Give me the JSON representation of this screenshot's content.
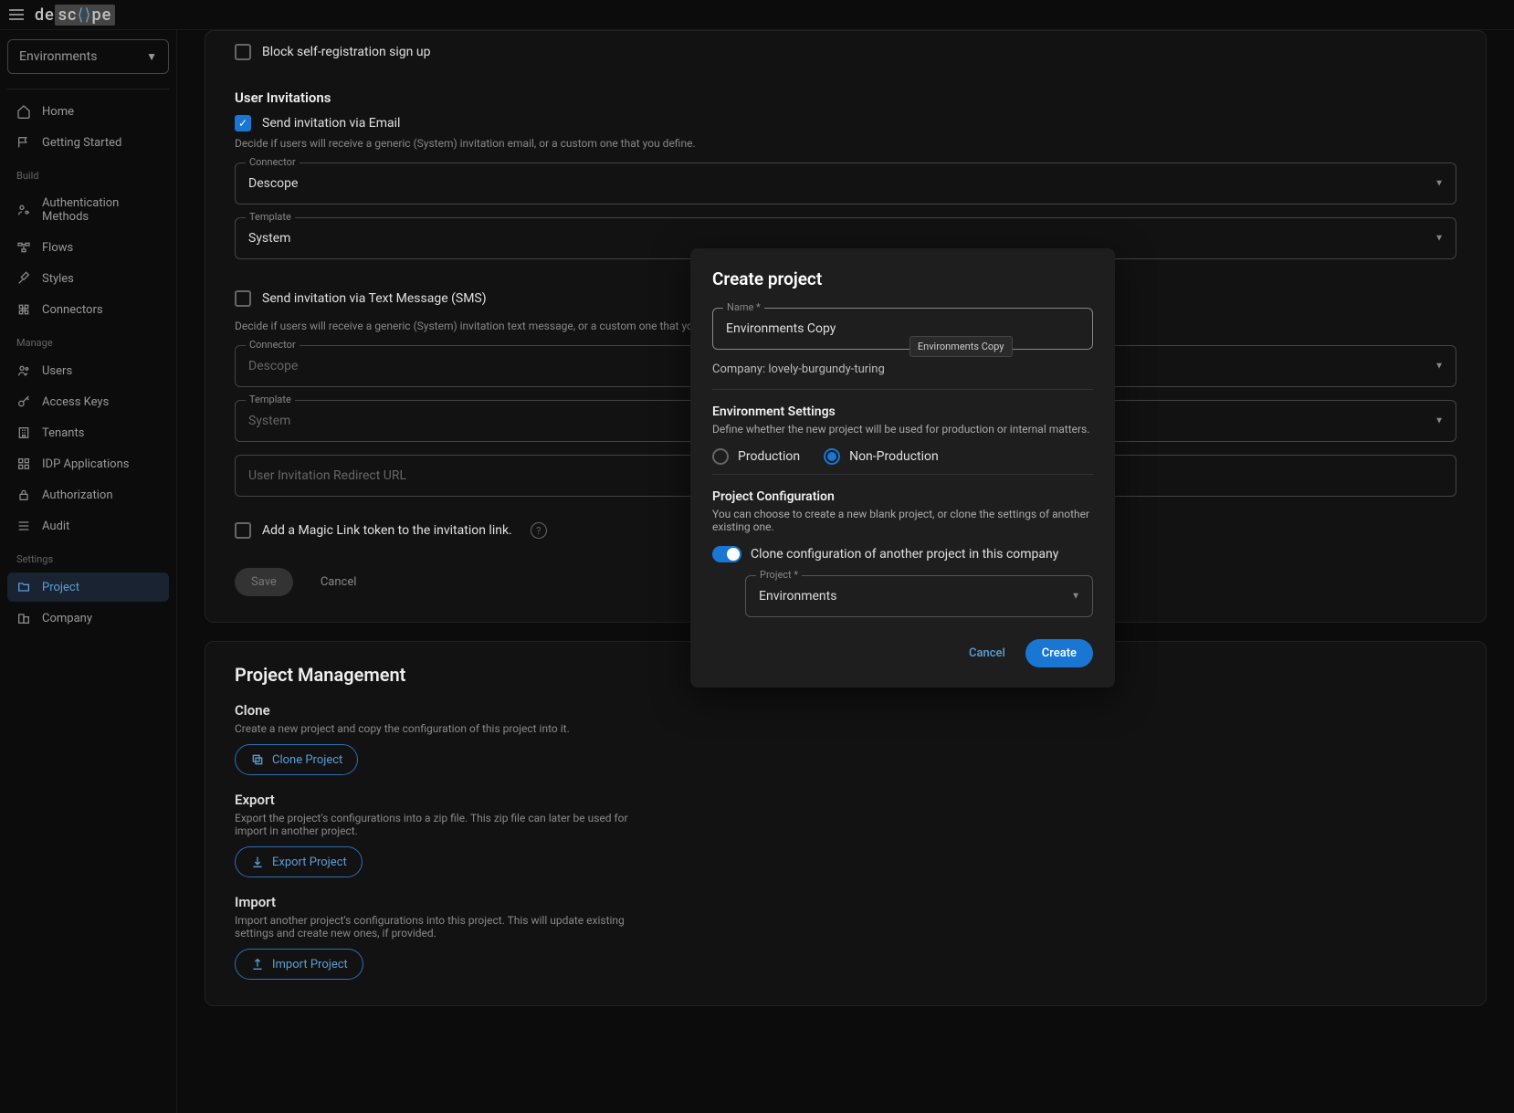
{
  "logo_text": "descope",
  "env_selector": "Environments",
  "sidebar": {
    "items_top": [
      {
        "label": "Home"
      },
      {
        "label": "Getting Started"
      }
    ],
    "section_build": "Build",
    "items_build": [
      {
        "label": "Authentication Methods"
      },
      {
        "label": "Flows"
      },
      {
        "label": "Styles"
      },
      {
        "label": "Connectors"
      }
    ],
    "section_manage": "Manage",
    "items_manage": [
      {
        "label": "Users"
      },
      {
        "label": "Access Keys"
      },
      {
        "label": "Tenants"
      },
      {
        "label": "IDP Applications"
      },
      {
        "label": "Authorization"
      },
      {
        "label": "Audit"
      }
    ],
    "section_settings": "Settings",
    "items_settings": [
      {
        "label": "Project"
      },
      {
        "label": "Company"
      }
    ]
  },
  "page": {
    "block_self_reg": "Block self-registration sign up",
    "user_invitations": "User Invitations",
    "send_email": "Send invitation via Email",
    "email_hint": "Decide if users will receive a generic (System) invitation email, or a custom one that you define.",
    "connector_label": "Connector",
    "connector_value": "Descope",
    "template_label": "Template",
    "template_value": "System",
    "send_sms": "Send invitation via Text Message (SMS)",
    "sms_hint": "Decide if users will receive a generic (System) invitation text message, or a custom one that you define.",
    "sms_connector_placeholder": "Descope",
    "sms_template_placeholder": "System",
    "redirect_placeholder": "User Invitation Redirect URL",
    "magic_link": "Add a Magic Link token to the invitation link.",
    "save": "Save",
    "cancel": "Cancel",
    "pm_title": "Project Management",
    "clone_title": "Clone",
    "clone_hint": "Create a new project and copy the configuration of this project into it.",
    "clone_btn": "Clone Project",
    "export_title": "Export",
    "export_hint": "Export the project's configurations into a zip file. This zip file can later be used for import in another project.",
    "export_btn": "Export Project",
    "import_title": "Import",
    "import_hint": "Import another project's configurations into this project. This will update existing settings and create new ones, if provided.",
    "import_btn": "Import Project"
  },
  "modal": {
    "title": "Create project",
    "name_label": "Name *",
    "name_value": "Environments Copy",
    "tooltip": "Environments Copy",
    "company": "Company: lovely-burgundy-turing",
    "env_title": "Environment Settings",
    "env_hint": "Define whether the new project will be used for production or internal matters.",
    "prod": "Production",
    "nonprod": "Non-Production",
    "config_title": "Project Configuration",
    "config_hint": "You can choose to create a new blank project, or clone the settings of another existing one.",
    "clone_toggle": "Clone configuration of another project in this company",
    "project_label": "Project *",
    "project_value": "Environments",
    "cancel": "Cancel",
    "create": "Create"
  }
}
